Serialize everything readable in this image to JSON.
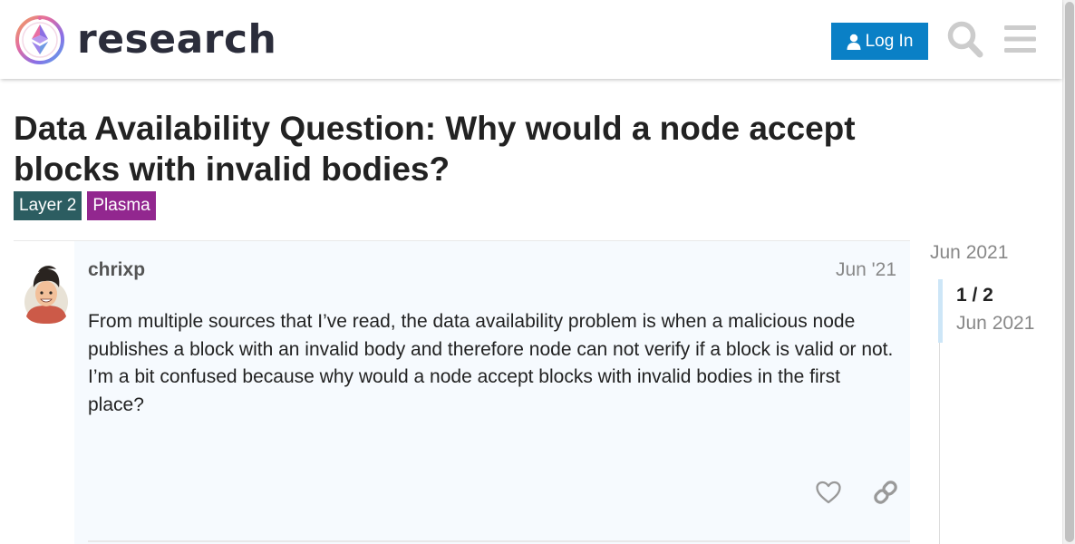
{
  "header": {
    "logo_text": "research",
    "logo_icon": "ethereum-research-logo-icon",
    "login_label": "Log In",
    "login_icon": "user-icon",
    "search_icon": "search-icon",
    "menu_icon": "hamburger-menu-icon",
    "colors": {
      "login_bg": "#0a80c6",
      "icon": "#cccccc"
    }
  },
  "topic": {
    "title": "Data Availability Question: Why would a node accept blocks with invalid bodies?",
    "tags": [
      {
        "label": "Layer 2",
        "color": "#2c5d61"
      },
      {
        "label": "Plasma",
        "color": "#92278f"
      }
    ]
  },
  "post": {
    "username": "chrixp",
    "date": "Jun '21",
    "body": "From multiple sources that I’ve read, the data availability problem is when a malicious node publishes a block with an invalid body and therefore node can not verify if a block is valid or not. I’m a bit confused because why would a node accept blocks with invalid bodies in the first place?",
    "actions": [
      "heart-icon",
      "link-icon"
    ]
  },
  "timeline": {
    "start_date": "Jun 2021",
    "position": "1 / 2",
    "current_date": "Jun 2021"
  }
}
